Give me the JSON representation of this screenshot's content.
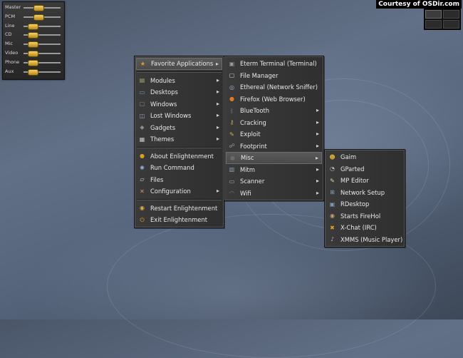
{
  "watermark": "Courtesy of OSDir.com",
  "mixer": {
    "channels": [
      {
        "label": "Master",
        "level": 0.35
      },
      {
        "label": "PCM",
        "level": 0.35
      },
      {
        "label": "Line",
        "level": 0.15
      },
      {
        "label": "CD",
        "level": 0.15
      },
      {
        "label": "Mic",
        "level": 0.15
      },
      {
        "label": "Video",
        "level": 0.15
      },
      {
        "label": "Phone",
        "level": 0.15
      },
      {
        "label": "Aux",
        "level": 0.15
      }
    ]
  },
  "main_menu": {
    "items": [
      {
        "label": "Favorite Applications",
        "icon": "favorite-apps-icon",
        "glyph": "★",
        "color": "#e0a030",
        "submenu": true,
        "highlighted": true
      },
      {
        "separator": true
      },
      {
        "label": "Modules",
        "icon": "modules-icon",
        "glyph": "▤",
        "color": "#9bb06a",
        "submenu": true
      },
      {
        "label": "Desktops",
        "icon": "desktops-icon",
        "glyph": "▭",
        "color": "#7f9ab8",
        "submenu": true
      },
      {
        "label": "Windows",
        "icon": "windows-icon",
        "glyph": "▢",
        "color": "#8a8fa0",
        "submenu": true
      },
      {
        "label": "Lost Windows",
        "icon": "lost-windows-icon",
        "glyph": "◫",
        "color": "#a0a8b8",
        "submenu": true
      },
      {
        "label": "Gadgets",
        "icon": "gadgets-icon",
        "glyph": "◆",
        "color": "#8a8a8a",
        "submenu": true
      },
      {
        "label": "Themes",
        "icon": "themes-icon",
        "glyph": "▦",
        "color": "#c8c8c8",
        "submenu": true
      },
      {
        "separator": true
      },
      {
        "label": "About Enlightenment",
        "icon": "about-icon",
        "glyph": "●",
        "color": "#d8a020",
        "submenu": false
      },
      {
        "label": "Run Command",
        "icon": "run-command-icon",
        "glyph": "✺",
        "color": "#8fb0d8",
        "submenu": false
      },
      {
        "label": "Files",
        "icon": "files-icon",
        "glyph": "▱",
        "color": "#d8d8d8",
        "submenu": false
      },
      {
        "label": "Configuration",
        "icon": "configuration-icon",
        "glyph": "✕",
        "color": "#c8a060",
        "submenu": true
      },
      {
        "separator": true
      },
      {
        "label": "Restart Enlightenment",
        "icon": "restart-icon",
        "glyph": "◉",
        "color": "#e0b040",
        "submenu": false
      },
      {
        "label": "Exit Enlightenment",
        "icon": "exit-icon",
        "glyph": "⏻",
        "color": "#e0a030",
        "submenu": false
      }
    ]
  },
  "favorites_menu": {
    "items": [
      {
        "label": "Eterm Terminal (Terminal)",
        "icon": "terminal-icon",
        "glyph": "▣",
        "color": "#9a9a9a",
        "submenu": false
      },
      {
        "label": "File Manager",
        "icon": "file-manager-icon",
        "glyph": "▢",
        "color": "#cfcfcf",
        "submenu": false
      },
      {
        "label": "Ethereal (Network Sniffer)",
        "icon": "ethereal-icon",
        "glyph": "◎",
        "color": "#9ab0c8",
        "submenu": false
      },
      {
        "label": "Firefox (Web Browser)",
        "icon": "firefox-icon",
        "glyph": "●",
        "color": "#e07a20",
        "submenu": false
      },
      {
        "label": "BlueTooth",
        "icon": "bluetooth-icon",
        "glyph": "ᛒ",
        "color": "#6f8ab8",
        "submenu": true
      },
      {
        "label": "Cracking",
        "icon": "cracking-icon",
        "glyph": "⚷",
        "color": "#c8a060",
        "submenu": true
      },
      {
        "label": "Exploit",
        "icon": "exploit-icon",
        "glyph": "✎",
        "color": "#d8b050",
        "submenu": true
      },
      {
        "label": "Footprint",
        "icon": "footprint-icon",
        "glyph": "☍",
        "color": "#a0a0a0",
        "submenu": true
      },
      {
        "label": "Misc",
        "icon": "misc-icon",
        "glyph": "●",
        "color": "#6a6a6a",
        "submenu": true,
        "highlighted": true
      },
      {
        "label": "Mitm",
        "icon": "mitm-icon",
        "glyph": "▥",
        "color": "#8aa0c0",
        "submenu": true
      },
      {
        "label": "Scanner",
        "icon": "scanner-icon",
        "glyph": "▭",
        "color": "#a0a8b0",
        "submenu": true
      },
      {
        "label": "Wifi",
        "icon": "wifi-icon",
        "glyph": "◠",
        "color": "#7a7a7a",
        "submenu": true
      }
    ]
  },
  "misc_menu": {
    "items": [
      {
        "label": "Gaim",
        "icon": "gaim-icon",
        "glyph": "☻",
        "color": "#e0b030"
      },
      {
        "label": "GParted",
        "icon": "gparted-icon",
        "glyph": "◔",
        "color": "#b0b8c8"
      },
      {
        "label": "MP Editor",
        "icon": "mp-editor-icon",
        "glyph": "✎",
        "color": "#d8d8b0"
      },
      {
        "label": "Network Setup",
        "icon": "network-setup-icon",
        "glyph": "⊞",
        "color": "#8aa0c0"
      },
      {
        "label": "RDesktop",
        "icon": "rdesktop-icon",
        "glyph": "▣",
        "color": "#7f9ab8"
      },
      {
        "label": "Starts FireHol",
        "icon": "firehol-icon",
        "glyph": "◉",
        "color": "#c0a070"
      },
      {
        "label": "X-Chat (IRC)",
        "icon": "xchat-icon",
        "glyph": "✖",
        "color": "#e0a020"
      },
      {
        "label": "XMMS (Music Player)",
        "icon": "xmms-icon",
        "glyph": "♪",
        "color": "#b0b0c0"
      }
    ]
  }
}
